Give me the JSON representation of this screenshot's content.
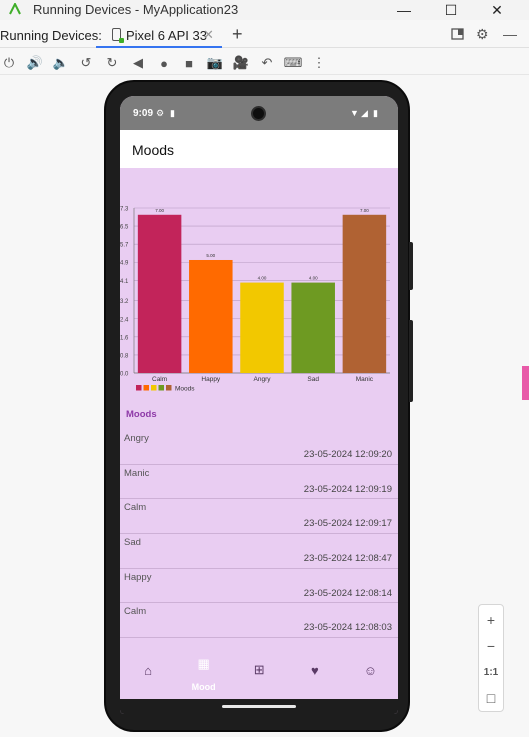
{
  "window": {
    "title": "Running Devices - MyApplication23",
    "controls": [
      "minimize",
      "maximize",
      "close"
    ]
  },
  "tabbar": {
    "label": "Running Devices:",
    "tab_label": "Pixel 6 API 33"
  },
  "toolbar": {
    "icons": [
      "power-icon",
      "volume-up-icon",
      "volume-down-icon",
      "rotate-left-icon",
      "rotate-right-icon",
      "back-icon",
      "home-icon",
      "overview-icon",
      "screenshot-icon",
      "screen-record-icon",
      "reset-icon",
      "keyboard-icon",
      "more-icon"
    ]
  },
  "device": {
    "status": {
      "time": "9:09"
    },
    "app_title": "Moods",
    "list_title": "Moods",
    "entries": [
      {
        "mood": "Angry",
        "time": "23-05-2024 12:09:20"
      },
      {
        "mood": "Manic",
        "time": "23-05-2024 12:09:19"
      },
      {
        "mood": "Calm",
        "time": "23-05-2024 12:09:17"
      },
      {
        "mood": "Sad",
        "time": "23-05-2024 12:08:47"
      },
      {
        "mood": "Happy",
        "time": "23-05-2024 12:08:14"
      },
      {
        "mood": "Calm",
        "time": "23-05-2024 12:08:03"
      }
    ],
    "nav": {
      "items": [
        {
          "icon": "home-icon",
          "label": ""
        },
        {
          "icon": "calendar-icon",
          "label": "Mood"
        },
        {
          "icon": "add-note-icon",
          "label": ""
        },
        {
          "icon": "heart-icon",
          "label": ""
        },
        {
          "icon": "bot-icon",
          "label": ""
        }
      ]
    }
  },
  "zoom": {
    "one_to_one": "1:1"
  },
  "chart_data": {
    "type": "bar",
    "categories": [
      "Calm",
      "Happy",
      "Angry",
      "Sad",
      "Manic"
    ],
    "values": [
      7.0,
      5.0,
      4.0,
      4.0,
      7.0
    ],
    "data_labels": [
      "7.00",
      "5.00",
      "4.00",
      "4.00",
      "7.00"
    ],
    "colors": [
      "#c2245a",
      "#ff6a00",
      "#f2c800",
      "#6e9a22",
      "#b06233"
    ],
    "y_ticks": [
      "0.0",
      "0.8",
      "1.6",
      "2.4",
      "3.2",
      "4.1",
      "4.9",
      "5.7",
      "6.5",
      "7.3"
    ],
    "ylim": [
      0,
      7.3
    ],
    "legend": "Moods",
    "legend_position": "bottom-left",
    "grid": true
  }
}
